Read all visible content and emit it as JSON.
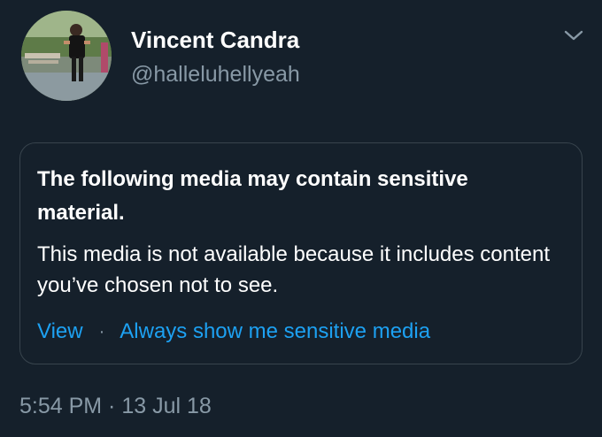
{
  "tweet": {
    "author": {
      "display_name": "Vincent Candra",
      "handle": "@halleluhellyeah",
      "avatar_icon": "user-avatar",
      "menu_icon": "chevron-down-icon"
    },
    "sensitive_notice": {
      "title": "The following media may contain sensitive material.",
      "body": "This media is not available because it includes content you’ve chosen not to see.",
      "view_label": "View",
      "separator": "·",
      "always_show_label": "Always show me sensitive media"
    },
    "timestamp": "5:54 PM · 13 Jul 18"
  },
  "colors": {
    "background": "#15202b",
    "text_primary": "#ffffff",
    "text_secondary": "#8899a6",
    "link": "#1da1f2",
    "card_border": "#38444d"
  }
}
